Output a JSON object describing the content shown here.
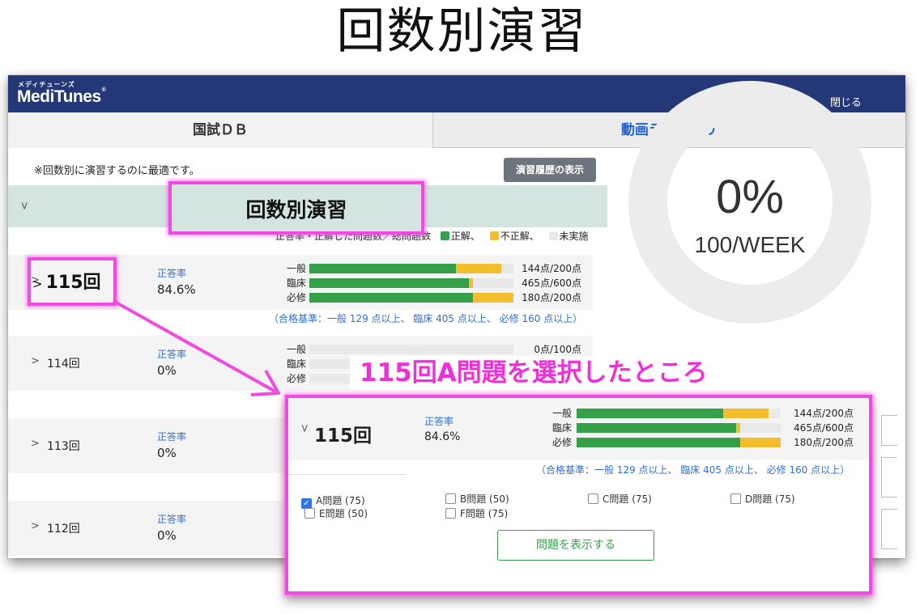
{
  "page_title": "回数別演習",
  "header": {
    "logo_kana": "メディチューンズ",
    "logo": "MediTunes",
    "logo_mark": "®",
    "close_label": "閉じる",
    "brand_color": "#243777"
  },
  "tabs": [
    {
      "label": "国試ＤＢ",
      "active": true
    },
    {
      "label": "動画ライブラリ",
      "active": false
    }
  ],
  "note": "※回数別に演習するのに最適です。",
  "history_button": "演習履歴の表示",
  "section_title": "回数別演習",
  "legend": {
    "prefix": "正答率・正解した問題数／総問題数",
    "correct": "正解、",
    "incorrect": "不正解、",
    "unanswered": "未実施",
    "colors": {
      "correct": "#34a04a",
      "incorrect": "#f3be2e",
      "unanswered": "#e9e9e9"
    }
  },
  "rate_label": "正答率",
  "bar_labels": [
    "一般",
    "臨床",
    "必修"
  ],
  "rows": [
    {
      "label": "115回",
      "rate": "84.6%",
      "bars": [
        {
          "correct": 0.72,
          "incorrect": 0.22
        },
        {
          "correct": 0.78,
          "incorrect": 0.02
        },
        {
          "correct": 0.8,
          "incorrect": 0.2
        }
      ],
      "scores": [
        "144点/200点",
        "465点/600点",
        "180点/200点"
      ],
      "criteria": "（合格基準：一般 129 点以上、 臨床 405 点以上、 必修 160 点以上）"
    },
    {
      "label": "114回",
      "rate": "0%",
      "scores": [
        "0点/100点"
      ]
    },
    {
      "label": "113回",
      "rate": "0%"
    },
    {
      "label": "112回",
      "rate": "0%"
    }
  ],
  "donut": {
    "percent": "0%",
    "subtitle": "100/WEEK",
    "progress": 0
  },
  "annotation": {
    "highlight_label": "115回",
    "caption": "115回A問題を選択したところ",
    "accent_color": "#f04be0"
  },
  "panel": {
    "label": "115回",
    "rate": "84.6%",
    "options": [
      {
        "label": "A問題 (75)",
        "checked": true
      },
      {
        "label": "B問題 (50)",
        "checked": false
      },
      {
        "label": "C問題 (75)",
        "checked": false
      },
      {
        "label": "D問題 (75)",
        "checked": false
      },
      {
        "label": "E問題 (50)",
        "checked": false
      },
      {
        "label": "F問題 (75)",
        "checked": false
      }
    ],
    "show_button": "問題を表示する"
  }
}
